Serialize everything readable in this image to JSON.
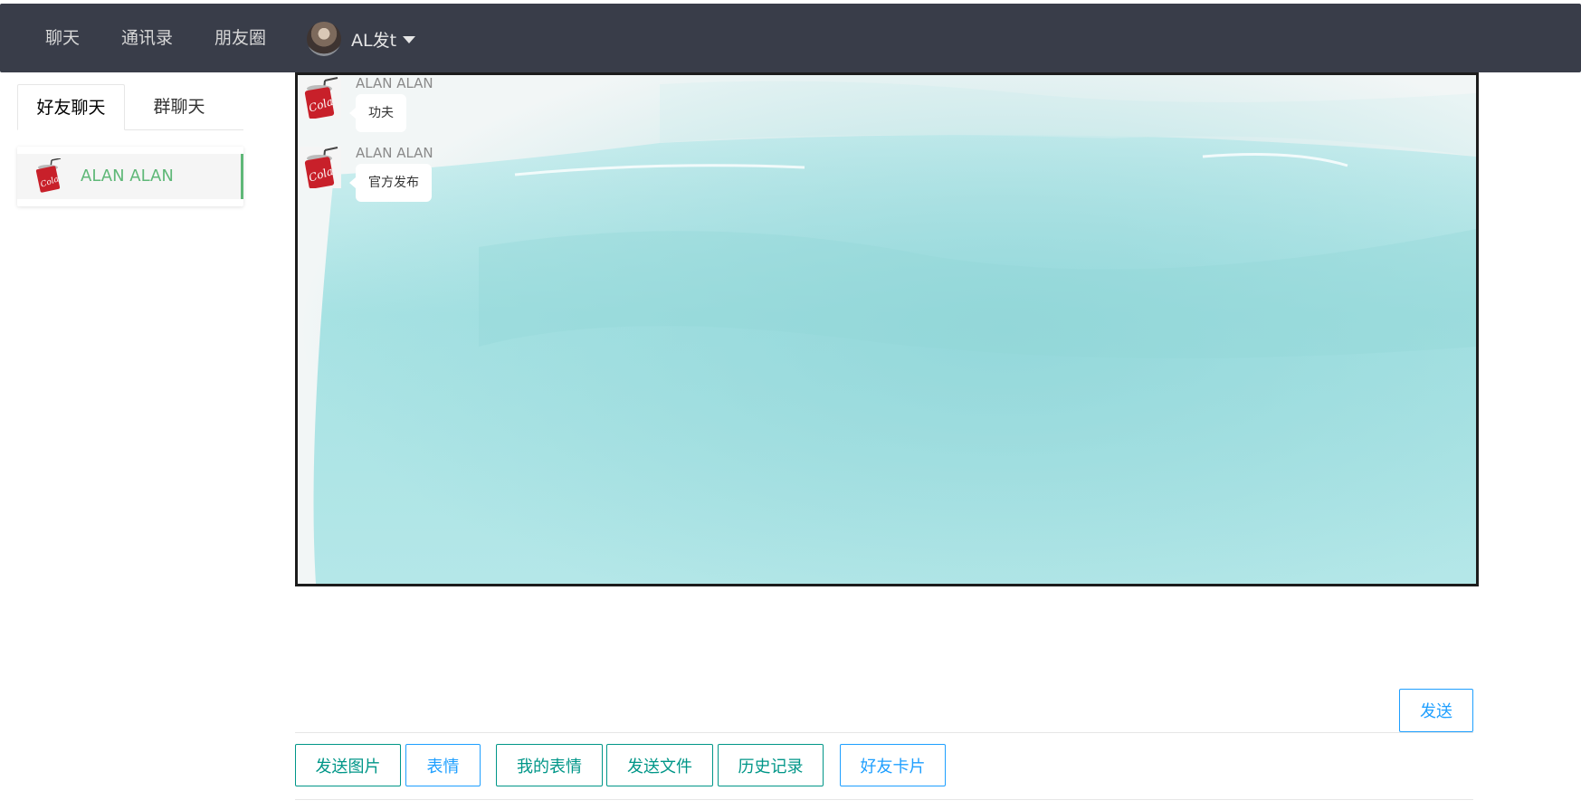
{
  "nav": {
    "items": [
      {
        "label": "聊天"
      },
      {
        "label": "通讯录"
      },
      {
        "label": "朋友圈"
      }
    ],
    "user": {
      "name": "AL发t",
      "avatar_icon": "user-avatar-photo"
    }
  },
  "sidebar": {
    "tabs": [
      {
        "label": "好友聊天",
        "active": true
      },
      {
        "label": "群聊天",
        "active": false
      }
    ],
    "friends": [
      {
        "name": "ALAN ALAN",
        "avatar_icon": "cola-can-avatar",
        "selected": true
      }
    ]
  },
  "chat": {
    "background": "watercolor-teal",
    "messages": [
      {
        "sender": "ALAN ALAN",
        "text": "功夫",
        "avatar_icon": "cola-can-avatar"
      },
      {
        "sender": "ALAN ALAN",
        "text": "官方发布",
        "avatar_icon": "cola-can-avatar"
      }
    ]
  },
  "composer": {
    "value": "",
    "send_label": "发送"
  },
  "toolbar": {
    "buttons": [
      {
        "label": "发送图片",
        "color": "#009688"
      },
      {
        "label": "表情",
        "color": "#1e9fff"
      },
      {
        "label": "我的表情",
        "color": "#009688"
      },
      {
        "label": "发送文件",
        "color": "#009688"
      },
      {
        "label": "历史记录",
        "color": "#009688"
      },
      {
        "label": "好友卡片",
        "color": "#1e9fff"
      }
    ]
  },
  "colors": {
    "nav_bg": "#393d49",
    "accent_green": "#5fb878",
    "accent_teal": "#009688",
    "accent_blue": "#1e9fff"
  }
}
